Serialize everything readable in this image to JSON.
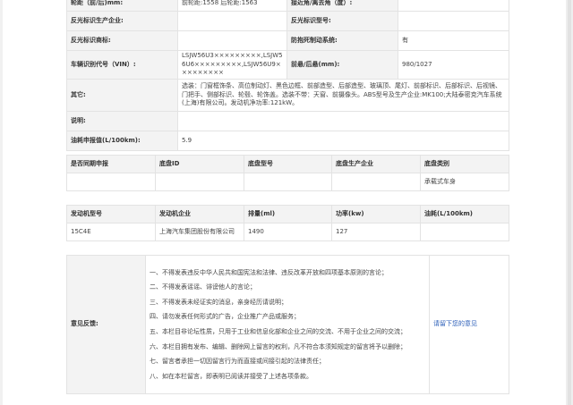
{
  "spec": {
    "rows": [
      {
        "k1": "轮距（前/后)mm:",
        "v1": "前轮距:1558 后轮距:1563",
        "k2": "接近角/离去角（度）:",
        "v2": ""
      },
      {
        "k1": "反光标识生产企业:",
        "v1": "",
        "k2": "反光标识型号:",
        "v2": ""
      },
      {
        "k1": "反光标识商标:",
        "v1": "",
        "k2": "防抱死制动系统:",
        "v2": "有"
      },
      {
        "k1": "车辆识别代号（VIN）:",
        "v1": "LSJW56U3×××××××××,LSJW56U6×××××××××,LSJW56U9×××××××××",
        "k2": "前悬/后悬(mm):",
        "v2": "980/1027"
      }
    ],
    "other_label": "其它:",
    "other_value": "选装：门窗框饰条、高位制动灯、黑色边框、前部造型、后部造型、玻璃顶、尾灯、前部标识、后部标识、后视镜、门把手、侧部标识、轮毂、轮饰盖。选装不带：天窗、前摄像头。ABS型号及生产企业:MK100;大陆泰密克汽车系统(上海)有限公司。发动机净功率:121kW。",
    "desc_label": "说明:",
    "desc_value": "",
    "fuel_label": "油耗申报值(L/100km):",
    "fuel_value": "5.9"
  },
  "chassis": {
    "headers": [
      "是否同期申报",
      "底盘ID",
      "底盘型号",
      "底盘生产企业",
      "底盘类别"
    ],
    "row": [
      "",
      "",
      "",
      "",
      "承载式车身"
    ]
  },
  "engine": {
    "headers": [
      "发动机型号",
      "发动机企业",
      "排量(ml)",
      "功率(kw)",
      "油耗(L/100km)"
    ],
    "row": [
      "15C4E",
      "上海汽车集团股份有限公司",
      "1490",
      "127",
      ""
    ]
  },
  "feedback": {
    "label": "意见反馈:",
    "rules": [
      "一、不得发表违反中华人民共和国宪法和法律、违反改革开放和四项基本原则的言论；",
      "二、不得发表谣谣、诽谤他人的言论；",
      "三、不得发表未经证实的消息，亲身经历请说明；",
      "四、请勿发表任何形式的广告，企业推广产品或服务；",
      "五、本栏目非论坛性质，只用于工业和信息化部和企业之间的交流、不用于企业之间的交流；",
      "六、本栏目拥有发布、编辑、删除网上留言的权利，凡不符合本须知规定的留言将予以删除；",
      "七、留言者承担一切因留言行为而直接或间接引起的法律责任；",
      "八、如在本栏留言，即表明已阅读并接受了上述各项条款。"
    ],
    "link": "请留下您的意见"
  }
}
